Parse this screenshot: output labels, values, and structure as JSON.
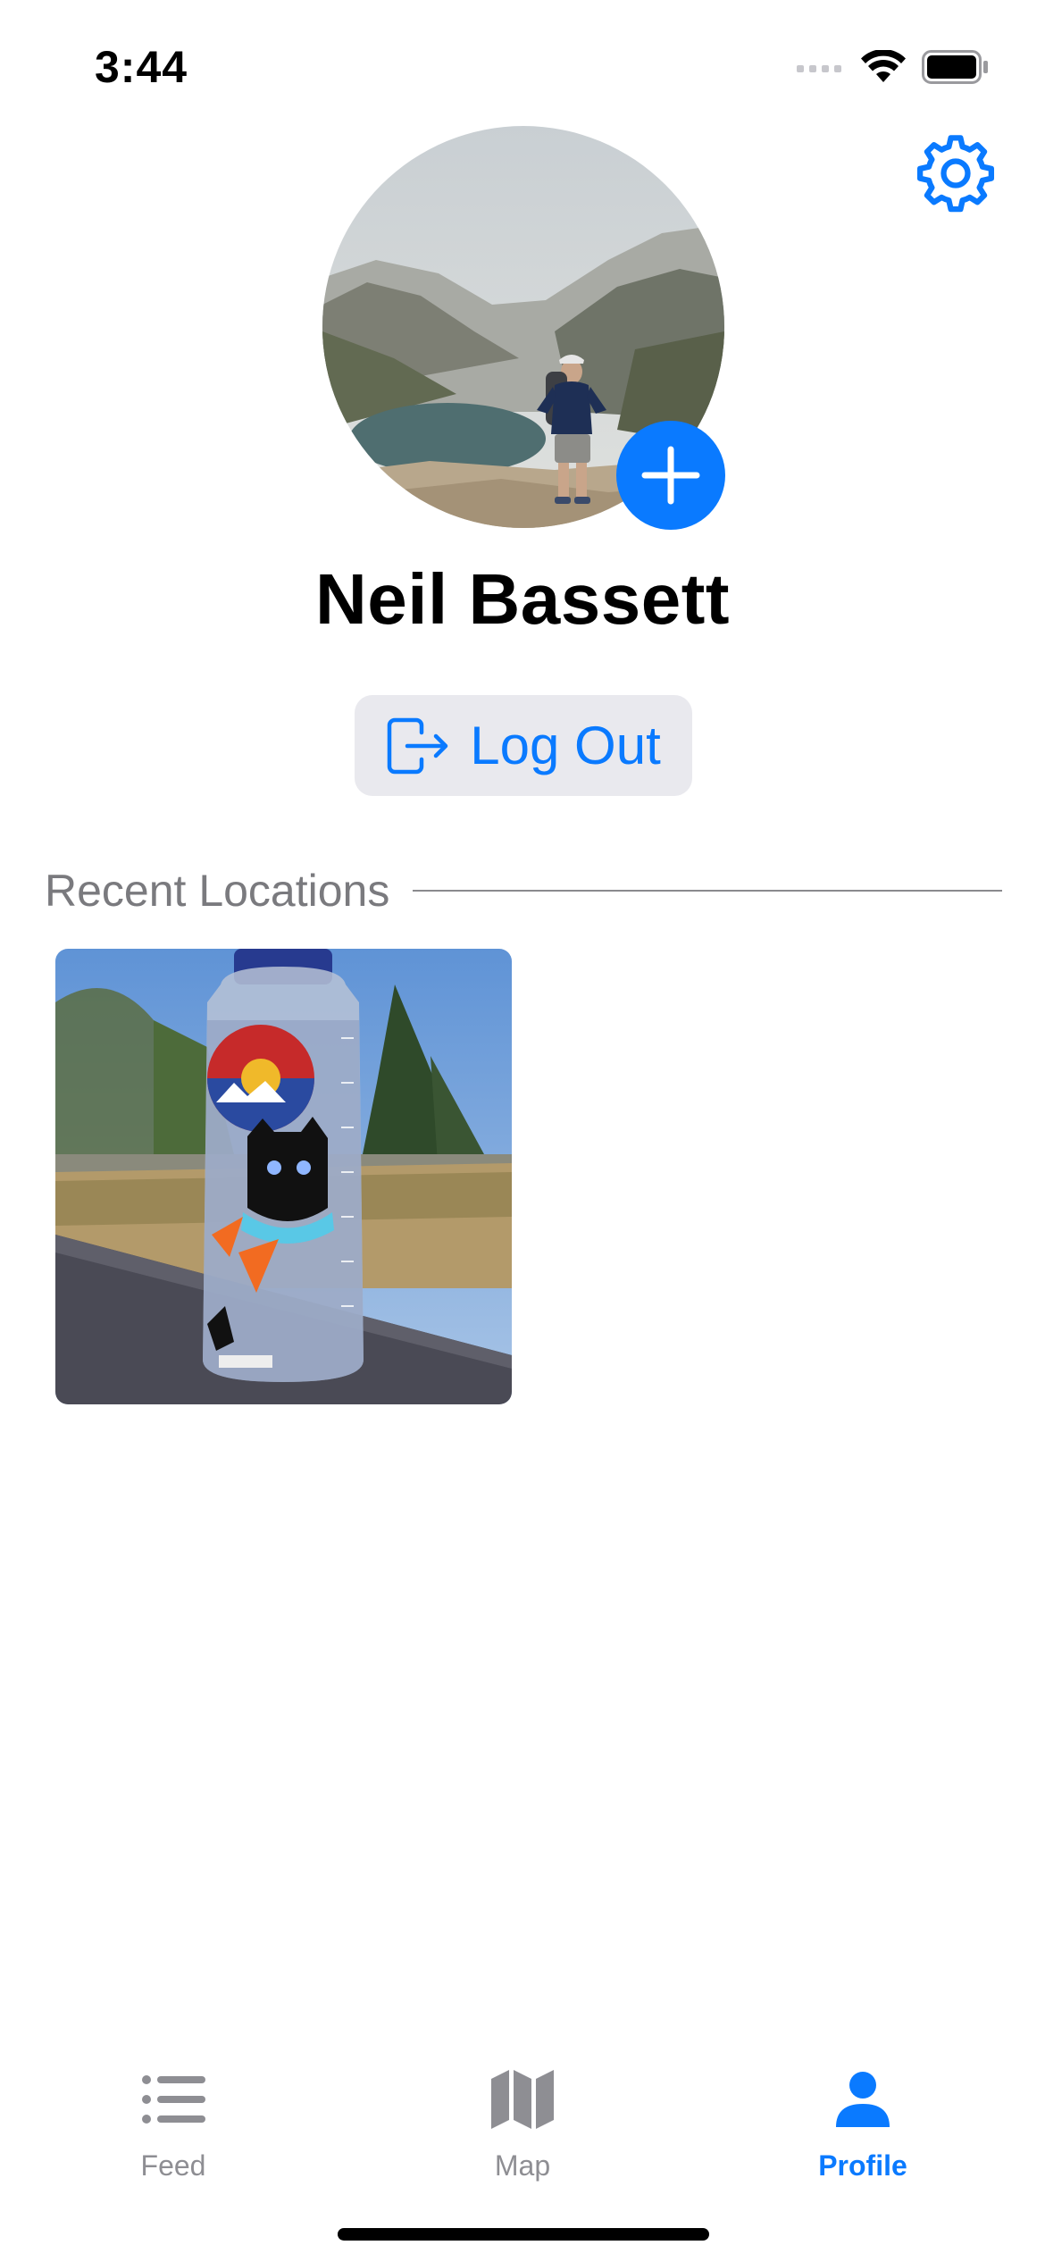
{
  "status_bar": {
    "time": "3:44"
  },
  "icons": {
    "settings": "gear-icon",
    "add_photo": "plus-icon",
    "logout": "logout-icon",
    "feed": "list-icon",
    "map": "map-icon",
    "profile": "person-icon"
  },
  "profile": {
    "name": "Neil Bassett"
  },
  "actions": {
    "logout_label": "Log Out"
  },
  "recent_locations": {
    "title": "Recent Locations",
    "items": [
      "water bottle photo"
    ]
  },
  "tab_bar": {
    "tabs": [
      {
        "label": "Feed",
        "active": false
      },
      {
        "label": "Map",
        "active": false
      },
      {
        "label": "Profile",
        "active": true
      }
    ]
  },
  "colors": {
    "accent": "#0a7aff",
    "inactive": "#8e8e93",
    "button_bg": "#e9e9ee"
  }
}
